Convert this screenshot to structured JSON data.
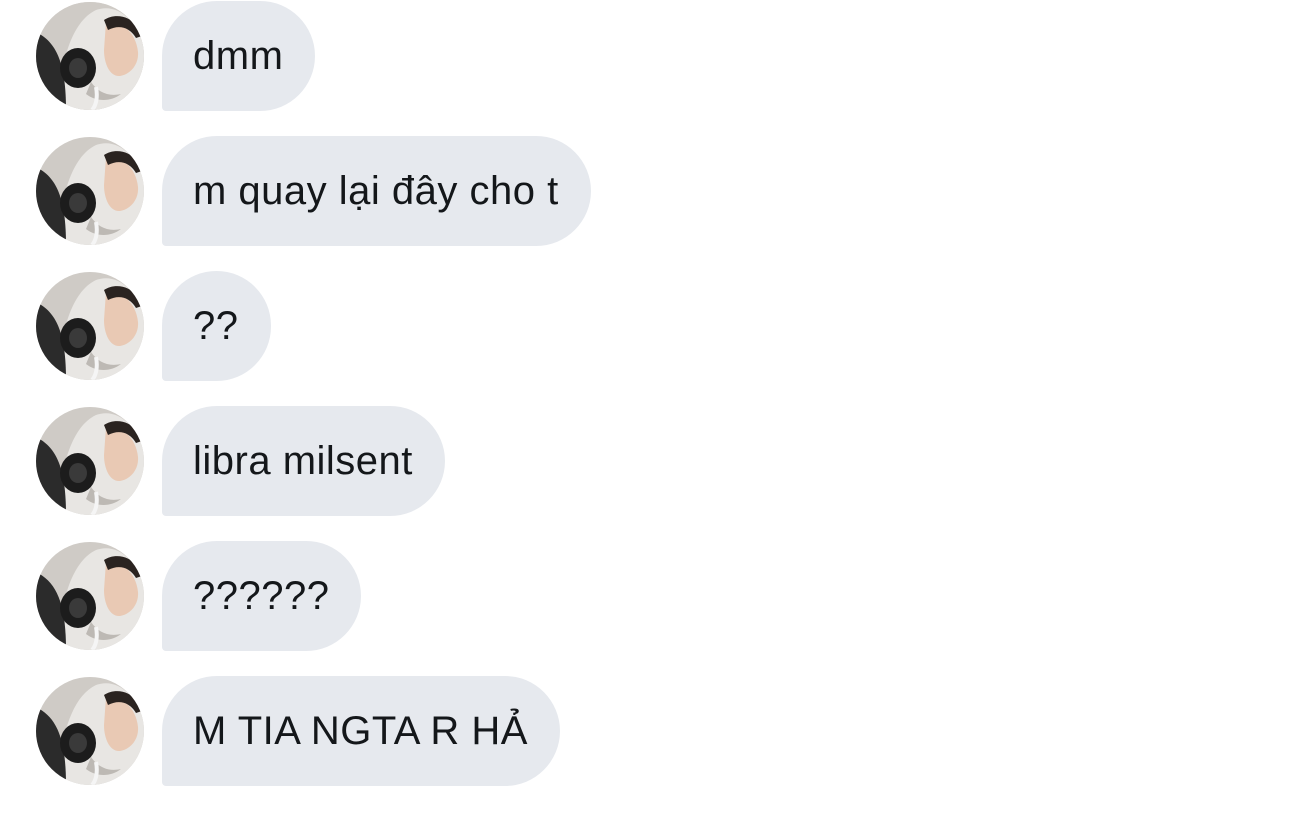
{
  "conversation": {
    "messages": [
      {
        "text": "dmm"
      },
      {
        "text": "m quay lại đây cho t"
      },
      {
        "text": "??"
      },
      {
        "text": "libra milsent"
      },
      {
        "text": "??????"
      },
      {
        "text": "M TIA NGTA R HẢ"
      }
    ]
  }
}
